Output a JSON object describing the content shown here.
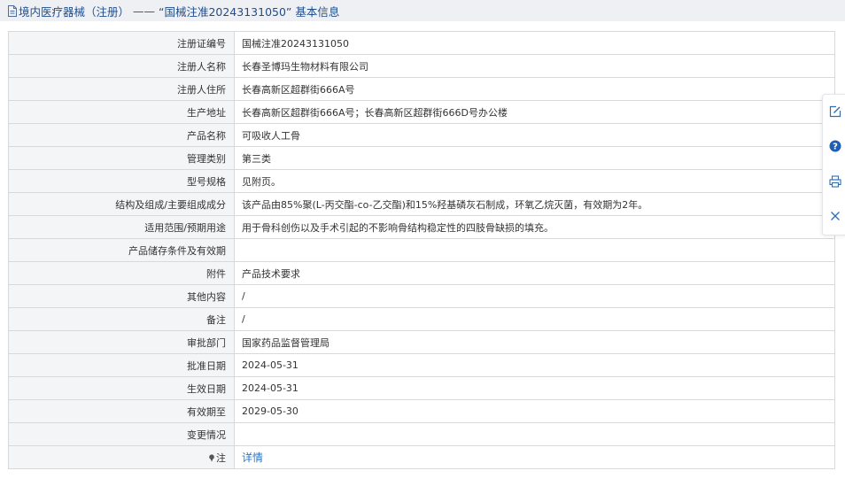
{
  "header": {
    "category": "境内医疗器械（注册）",
    "separator": " —— ",
    "cert_quoted": "“国械注准20243131050”",
    "suffix": " 基本信息"
  },
  "rows": [
    {
      "label": "注册证编号",
      "value": "国械注准20243131050"
    },
    {
      "label": "注册人名称",
      "value": "长春圣博玛生物材料有限公司"
    },
    {
      "label": "注册人住所",
      "value": "长春高新区超群街666A号"
    },
    {
      "label": "生产地址",
      "value": "长春高新区超群街666A号；长春高新区超群街666D号办公楼"
    },
    {
      "label": "产品名称",
      "value": "可吸收人工骨"
    },
    {
      "label": "管理类别",
      "value": "第三类"
    },
    {
      "label": "型号规格",
      "value": "见附页。"
    },
    {
      "label": "结构及组成/主要组成成分",
      "value": "该产品由85%聚(L-丙交酯-co-乙交酯)和15%羟基磷灰石制成，环氧乙烷灭菌，有效期为2年。"
    },
    {
      "label": "适用范围/预期用途",
      "value": "用于骨科创伤以及手术引起的不影响骨结构稳定性的四肢骨缺损的填充。"
    },
    {
      "label": "产品储存条件及有效期",
      "value": ""
    },
    {
      "label": "附件",
      "value": "产品技术要求"
    },
    {
      "label": "其他内容",
      "value": "/"
    },
    {
      "label": "备注",
      "value": "/"
    },
    {
      "label": "审批部门",
      "value": "国家药品监督管理局"
    },
    {
      "label": "批准日期",
      "value": "2024-05-31"
    },
    {
      "label": "生效日期",
      "value": "2024-05-31"
    },
    {
      "label": "有效期至",
      "value": "2029-05-30"
    },
    {
      "label": "变更情况",
      "value": ""
    }
  ],
  "note_row": {
    "label": "注",
    "link": "详情"
  },
  "icons": {
    "header": "document-icon",
    "note": "pin-icon",
    "sidebar": [
      "edit-icon",
      "help-icon",
      "print-icon",
      "close-icon"
    ]
  },
  "colors": {
    "header_bg": "#eef0f3",
    "header_text": "#1f4e8c",
    "label_bg": "#f4f5f6",
    "border": "#d7d9dc",
    "link": "#2a78c8"
  }
}
